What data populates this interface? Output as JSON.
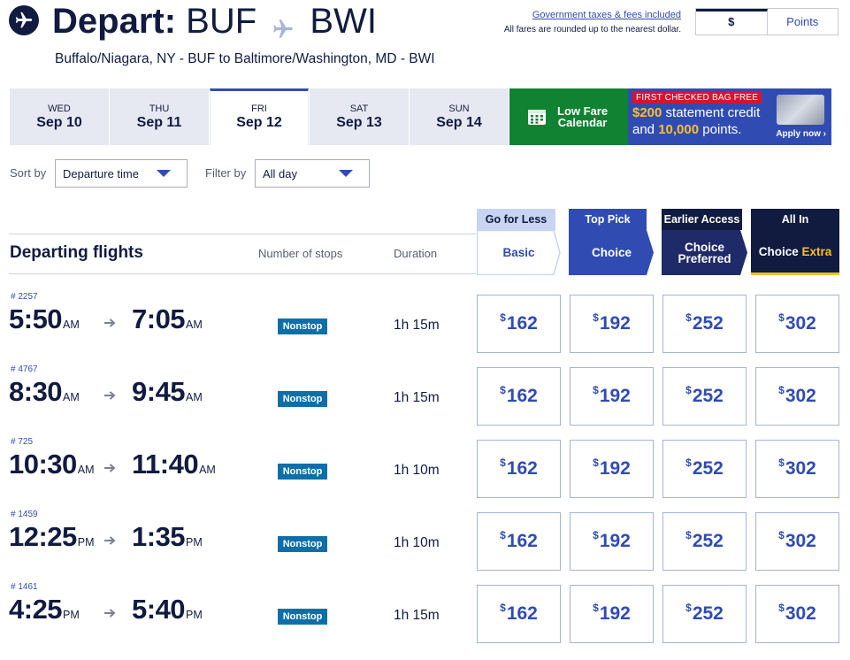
{
  "header": {
    "title_bold": "Depart:",
    "origin": "BUF",
    "destination": "BWI",
    "subtitle": "Buffalo/Niagara, NY - BUF to Baltimore/Washington, MD - BWI",
    "tax_link": "Government taxes & fees included",
    "tax_note": "All fares are rounded up to the nearest dollar.",
    "currency_toggle": {
      "dollars": "$",
      "points": "Points"
    }
  },
  "date_tabs": [
    {
      "dow": "WED",
      "date": "Sep 10"
    },
    {
      "dow": "THU",
      "date": "Sep 11"
    },
    {
      "dow": "FRI",
      "date": "Sep 12"
    },
    {
      "dow": "SAT",
      "date": "Sep 13"
    },
    {
      "dow": "SUN",
      "date": "Sep 14"
    }
  ],
  "low_fare": {
    "line1": "Low Fare",
    "line2": "Calendar"
  },
  "promo": {
    "badge": "FIRST CHECKED BAG FREE",
    "amount": "$200",
    "line1_rest": " statement credit",
    "line2_start": "and ",
    "points": "10,000",
    "line2_end": " points.",
    "apply": "Apply now"
  },
  "sort": {
    "label": "Sort by",
    "value": "Departure time"
  },
  "filter": {
    "label": "Filter by",
    "value": "All day"
  },
  "fare_headers": [
    {
      "top": "Go for Less",
      "name": "Basic",
      "name2": ""
    },
    {
      "top": "Top Pick",
      "name": "Choice",
      "name2": ""
    },
    {
      "top": "Earlier Access",
      "name": "Choice",
      "name2": "Preferred"
    },
    {
      "top": "All In",
      "name": "Choice",
      "name2": "Extra"
    }
  ],
  "columns": {
    "title": "Departing flights",
    "stops": "Number of stops",
    "duration": "Duration"
  },
  "flights": [
    {
      "number": "# 2257",
      "dep": "5:50",
      "dep_ampm": "AM",
      "arr": "7:05",
      "arr_ampm": "AM",
      "stops": "Nonstop",
      "duration": "1h 15m",
      "fares": [
        "162",
        "192",
        "252",
        "302"
      ]
    },
    {
      "number": "# 4767",
      "dep": "8:30",
      "dep_ampm": "AM",
      "arr": "9:45",
      "arr_ampm": "AM",
      "stops": "Nonstop",
      "duration": "1h 15m",
      "fares": [
        "162",
        "192",
        "252",
        "302"
      ]
    },
    {
      "number": "# 725",
      "dep": "10:30",
      "dep_ampm": "AM",
      "arr": "11:40",
      "arr_ampm": "AM",
      "stops": "Nonstop",
      "duration": "1h 10m",
      "fares": [
        "162",
        "192",
        "252",
        "302"
      ]
    },
    {
      "number": "# 1459",
      "dep": "12:25",
      "dep_ampm": "PM",
      "arr": "1:35",
      "arr_ampm": "PM",
      "stops": "Nonstop",
      "duration": "1h 10m",
      "fares": [
        "162",
        "192",
        "252",
        "302"
      ]
    },
    {
      "number": "# 1461",
      "dep": "4:25",
      "dep_ampm": "PM",
      "arr": "5:40",
      "arr_ampm": "PM",
      "stops": "Nonstop",
      "duration": "1h 15m",
      "fares": [
        "162",
        "192",
        "252",
        "302"
      ]
    }
  ],
  "currency_symbol": "$",
  "colors": {
    "navy": "#111b40",
    "blue": "#304cb2",
    "light_blue": "#c7d4f2",
    "green": "#118232",
    "gold": "#ffbf27",
    "nonstop": "#0e6fa8"
  }
}
